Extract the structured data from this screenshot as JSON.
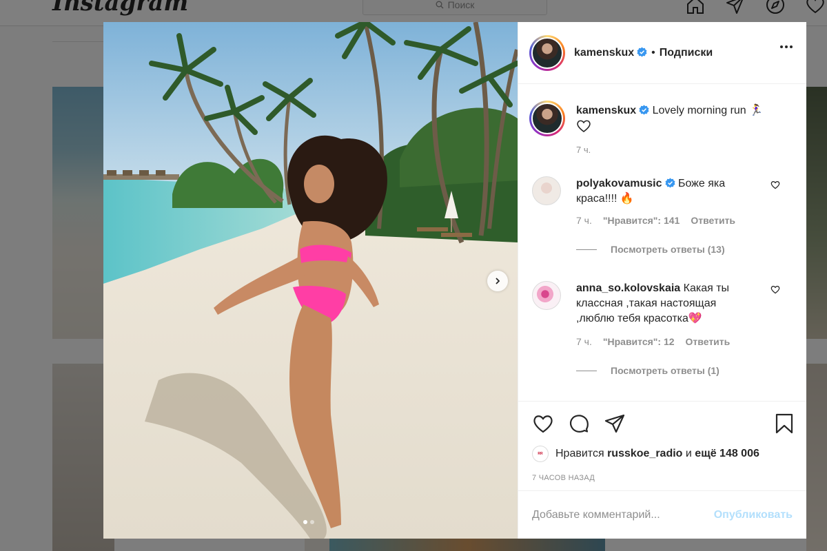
{
  "app": {
    "logo_text": "Instagram",
    "search_placeholder": "Поиск",
    "top_icons": [
      "home-icon",
      "direct-icon",
      "explore-icon",
      "activity-heart-icon"
    ]
  },
  "post": {
    "username": "kamenskux",
    "verified": true,
    "separator": "•",
    "follow_label": "Подписки",
    "photo_count": 2,
    "photo_active_index": 0,
    "caption_text": "Lovely morning run 🏃‍♀️",
    "caption_time": "7 ч.",
    "comments": [
      {
        "username": "polyakovamusic",
        "verified": true,
        "text": "Боже яка краса!!!! 🔥",
        "time": "7 ч.",
        "likes": "\"Нравится\": 141",
        "reply_label": "Ответить",
        "view_replies": "Посмотреть ответы (13)"
      },
      {
        "username": "anna_so.kolovskaia",
        "verified": false,
        "text": "Какая ты классная ,такая настоящая ,люблю тебя красотка💖",
        "time": "7 ч.",
        "likes": "\"Нравится\": 12",
        "reply_label": "Ответить",
        "view_replies": "Посмотреть ответы (1)"
      }
    ],
    "likes_prefix": "Нравится",
    "likes_user": "russkoe_radio",
    "likes_middle": "и",
    "likes_rest": "ещё 148 006",
    "post_time": "7 ЧАСОВ НАЗАД",
    "comment_placeholder": "Добавьте комментарий...",
    "publish_label": "Опубликовать"
  },
  "colors": {
    "verified_blue": "#3897f0",
    "publish_disabled": "#b2dffc",
    "secondary_text": "#8e8e8e"
  }
}
